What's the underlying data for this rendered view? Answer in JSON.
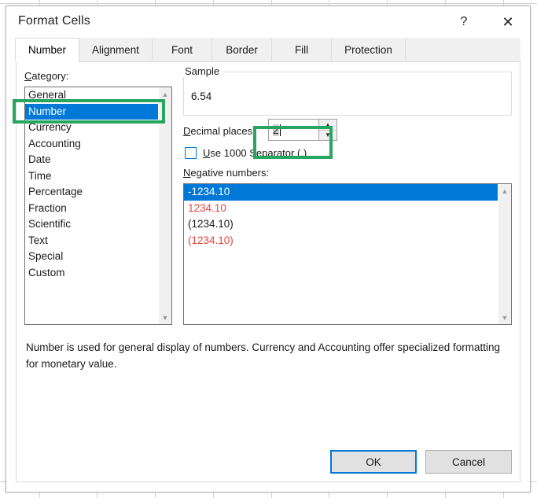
{
  "window": {
    "title": "Format Cells",
    "help_icon": "?",
    "close_icon": "✕"
  },
  "tabs": [
    {
      "label": "Number",
      "selected": true
    },
    {
      "label": "Alignment",
      "selected": false
    },
    {
      "label": "Font",
      "selected": false
    },
    {
      "label": "Border",
      "selected": false
    },
    {
      "label": "Fill",
      "selected": false
    },
    {
      "label": "Protection",
      "selected": false
    }
  ],
  "category": {
    "label": "Category:",
    "items": [
      {
        "label": "General",
        "selected": false
      },
      {
        "label": "Number",
        "selected": true
      },
      {
        "label": "Currency",
        "selected": false
      },
      {
        "label": "Accounting",
        "selected": false
      },
      {
        "label": "Date",
        "selected": false
      },
      {
        "label": "Time",
        "selected": false
      },
      {
        "label": "Percentage",
        "selected": false
      },
      {
        "label": "Fraction",
        "selected": false
      },
      {
        "label": "Scientific",
        "selected": false
      },
      {
        "label": "Text",
        "selected": false
      },
      {
        "label": "Special",
        "selected": false
      },
      {
        "label": "Custom",
        "selected": false
      }
    ],
    "scroll_up_icon": "▲",
    "scroll_down_icon": "▼"
  },
  "sample": {
    "legend": "Sample",
    "value": "6.54"
  },
  "decimal_places": {
    "label": "Decimal places:",
    "value": "2",
    "spin_up_icon": "▲",
    "spin_down_icon": "▼"
  },
  "thousand_separator": {
    "label": "Use 1000 Separator (,)",
    "checked": false
  },
  "negative_numbers": {
    "label": "Negative numbers:",
    "items": [
      {
        "text": "-1234.10",
        "color": "#000000",
        "selected": true
      },
      {
        "text": "1234.10",
        "color": "#e8443a",
        "selected": false
      },
      {
        "text": "(1234.10)",
        "color": "#1a1a1a",
        "selected": false
      },
      {
        "text": "(1234.10)",
        "color": "#e8443a",
        "selected": false
      }
    ],
    "scroll_up_icon": "▲",
    "scroll_down_icon": "▼"
  },
  "description": "Number is used for general display of numbers.  Currency and Accounting offer specialized formatting for monetary value.",
  "footer": {
    "ok_label": "OK",
    "cancel_label": "Cancel"
  },
  "annotations": {
    "highlight_color": "#28a55f",
    "boxes": [
      {
        "target": "category-item-number"
      },
      {
        "target": "decimal-places-spinner"
      }
    ]
  }
}
